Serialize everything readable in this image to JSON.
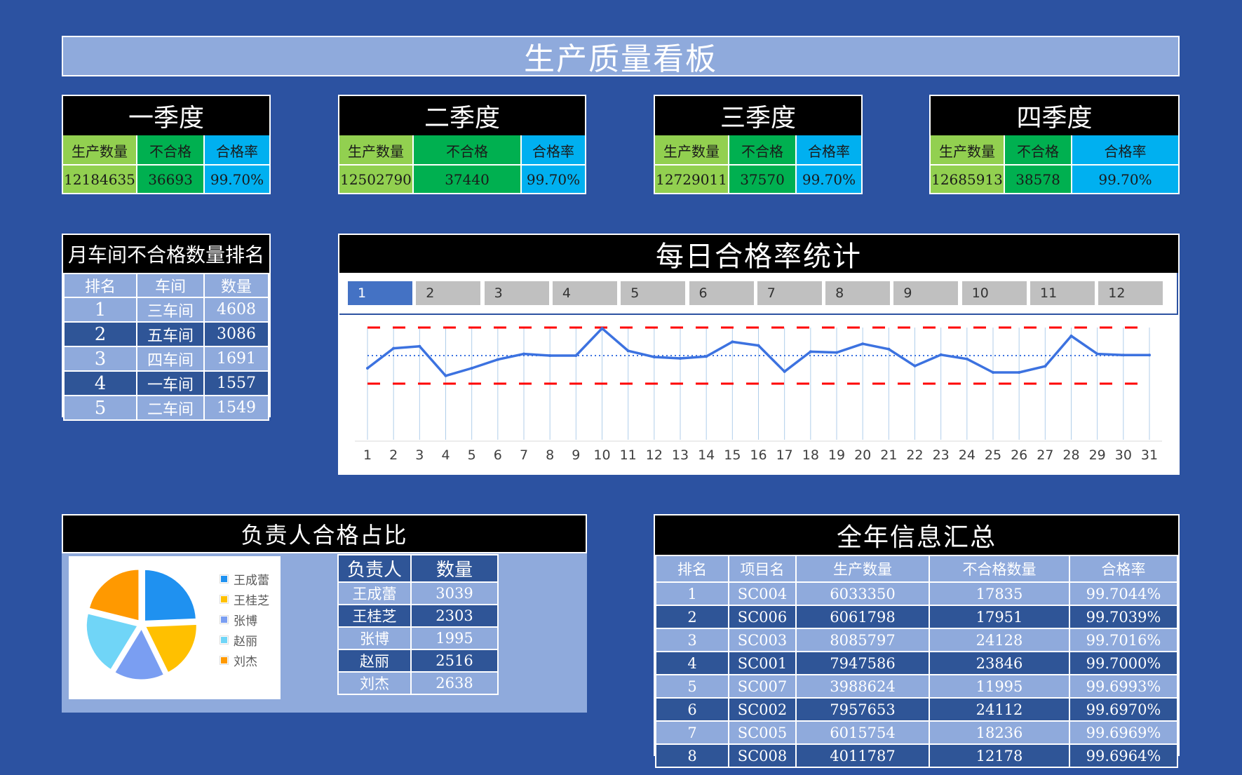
{
  "header": {
    "title": "生产质量看板"
  },
  "quarters": [
    {
      "title": "一季度",
      "col_labels": [
        "生产数量",
        "不合格",
        "合格率"
      ],
      "production": "12184635",
      "defects": "36693",
      "pass_rate": "99.70%"
    },
    {
      "title": "二季度",
      "col_labels": [
        "生产数量",
        "不合格",
        "合格率"
      ],
      "production": "12502790",
      "defects": "37440",
      "pass_rate": "99.70%"
    },
    {
      "title": "三季度",
      "col_labels": [
        "生产数量",
        "不合格",
        "合格率"
      ],
      "production": "12729011",
      "defects": "37570",
      "pass_rate": "99.70%"
    },
    {
      "title": "四季度",
      "col_labels": [
        "生产数量",
        "不合格",
        "合格率"
      ],
      "production": "12685913",
      "defects": "38578",
      "pass_rate": "99.70%"
    }
  ],
  "workshop_ranking": {
    "title": "月车间不合格数量排名",
    "headers": [
      "排名",
      "车间",
      "数量"
    ],
    "rows": [
      [
        "1",
        "三车间",
        "4608"
      ],
      [
        "2",
        "五车间",
        "3086"
      ],
      [
        "3",
        "四车间",
        "1691"
      ],
      [
        "4",
        "一车间",
        "1557"
      ],
      [
        "5",
        "二车间",
        "1549"
      ]
    ]
  },
  "daily": {
    "title": "每日合格率统计",
    "month_tabs": [
      "1",
      "2",
      "3",
      "4",
      "5",
      "6",
      "7",
      "8",
      "9",
      "10",
      "11",
      "12"
    ],
    "active_month": "1"
  },
  "chart_data": [
    {
      "type": "line",
      "x": [
        1,
        2,
        3,
        4,
        5,
        6,
        7,
        8,
        9,
        10,
        11,
        12,
        13,
        14,
        15,
        16,
        17,
        18,
        19,
        20,
        21,
        22,
        23,
        24,
        25,
        26,
        27,
        28,
        29,
        30,
        31
      ],
      "categories": [
        "1",
        "2",
        "3",
        "4",
        "5",
        "6",
        "7",
        "8",
        "9",
        "10",
        "11",
        "12",
        "13",
        "14",
        "15",
        "16",
        "17",
        "18",
        "19",
        "20",
        "21",
        "22",
        "23",
        "24",
        "25",
        "26",
        "27",
        "28",
        "29",
        "30",
        "31"
      ],
      "series": [
        {
          "values": [
            -0.45,
            0.26,
            0.33,
            -0.72,
            -0.45,
            -0.14,
            0.06,
            0.0,
            0.0,
            0.97,
            0.17,
            -0.05,
            -0.1,
            -0.03,
            0.49,
            0.36,
            -0.57,
            0.14,
            0.11,
            0.42,
            0.23,
            -0.37,
            0.03,
            -0.12,
            -0.6,
            -0.6,
            -0.38,
            0.7,
            0.06,
            0.02,
            0.02
          ]
        }
      ],
      "mean": 0.0,
      "upper_limit": 1.0,
      "lower_limit": -1.0,
      "ylim": [
        -2.8,
        1.2
      ],
      "xlabel": "",
      "ylabel": "",
      "title": "",
      "colors": {
        "line": "#3c72e0",
        "mean": "#3c72e0",
        "limits": "#ff0000",
        "drop": "#9dc3e6"
      }
    },
    {
      "type": "pie",
      "categories": [
        "王成蕾",
        "王桂芝",
        "张博",
        "赵丽",
        "刘杰"
      ],
      "values": [
        3039,
        2303,
        1995,
        2516,
        2638
      ],
      "colors": [
        "#1f91f0",
        "#ffc000",
        "#7a9ef2",
        "#70d5f7",
        "#ff9900"
      ],
      "legend": "right"
    }
  ],
  "owner_share": {
    "title": "负责人合格占比",
    "headers": [
      "负责人",
      "数量"
    ],
    "rows": [
      [
        "王成蕾",
        "3039"
      ],
      [
        "王桂芝",
        "2303"
      ],
      [
        "张博",
        "1995"
      ],
      [
        "赵丽",
        "2516"
      ],
      [
        "刘杰",
        "2638"
      ]
    ]
  },
  "annual_summary": {
    "title": "全年信息汇总",
    "headers": [
      "排名",
      "项目名",
      "生产数量",
      "不合格数量",
      "合格率"
    ],
    "rows": [
      [
        "1",
        "SC004",
        "6033350",
        "17835",
        "99.7044%"
      ],
      [
        "2",
        "SC006",
        "6061798",
        "17951",
        "99.7039%"
      ],
      [
        "3",
        "SC003",
        "8085797",
        "24128",
        "99.7016%"
      ],
      [
        "4",
        "SC001",
        "7947586",
        "23846",
        "99.7000%"
      ],
      [
        "5",
        "SC007",
        "3988624",
        "11995",
        "99.6993%"
      ],
      [
        "6",
        "SC002",
        "7957653",
        "24112",
        "99.6970%"
      ],
      [
        "7",
        "SC005",
        "6015754",
        "18236",
        "99.6969%"
      ],
      [
        "8",
        "SC008",
        "4011787",
        "12178",
        "99.6964%"
      ]
    ]
  }
}
